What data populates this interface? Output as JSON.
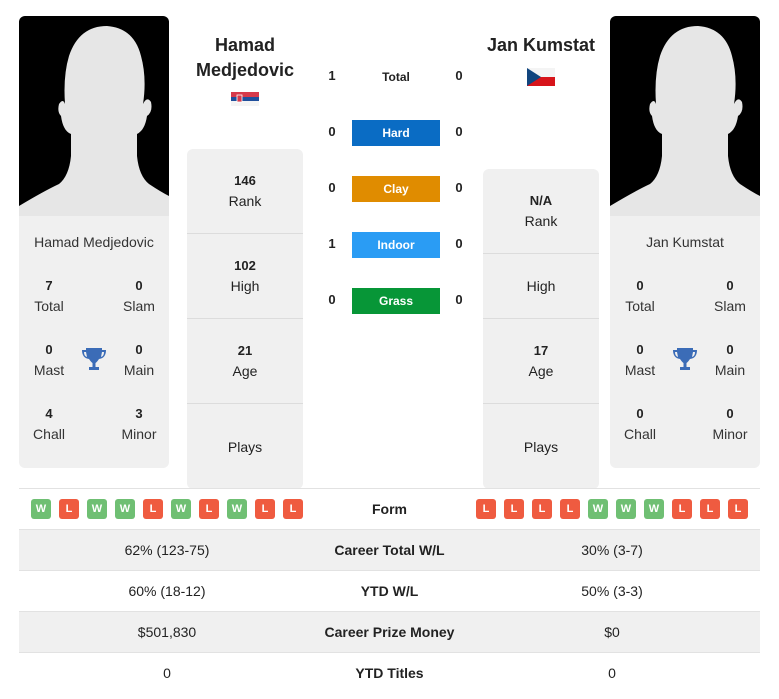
{
  "player1": {
    "name": "Hamad Medjedovic",
    "title_line1": "Hamad",
    "title_line2": "Medjedovic",
    "flag": "serbia-flag",
    "titles": {
      "total": {
        "value": "7",
        "label": "Total"
      },
      "slam": {
        "value": "0",
        "label": "Slam"
      },
      "mast": {
        "value": "0",
        "label": "Mast"
      },
      "main": {
        "value": "0",
        "label": "Main"
      },
      "chall": {
        "value": "4",
        "label": "Chall"
      },
      "minor": {
        "value": "3",
        "label": "Minor"
      }
    },
    "rank": {
      "value": "146",
      "label": "Rank"
    },
    "high": {
      "value": "102",
      "label": "High"
    },
    "age": {
      "value": "21",
      "label": "Age"
    },
    "plays": {
      "value": "",
      "label": "Plays"
    }
  },
  "player2": {
    "name": "Jan Kumstat",
    "title_line1": "Jan Kumstat",
    "flag": "czech-flag",
    "titles": {
      "total": {
        "value": "0",
        "label": "Total"
      },
      "slam": {
        "value": "0",
        "label": "Slam"
      },
      "mast": {
        "value": "0",
        "label": "Mast"
      },
      "main": {
        "value": "0",
        "label": "Main"
      },
      "chall": {
        "value": "0",
        "label": "Chall"
      },
      "minor": {
        "value": "0",
        "label": "Minor"
      }
    },
    "rank": {
      "value": "N/A",
      "label": "Rank"
    },
    "high": {
      "value": "",
      "label": "High"
    },
    "age": {
      "value": "17",
      "label": "Age"
    },
    "plays": {
      "value": "",
      "label": "Plays"
    }
  },
  "h2h": {
    "total": {
      "label": "Total",
      "p1": "1",
      "p2": "0"
    },
    "surfaces": [
      {
        "label": "Hard",
        "p1": "0",
        "p2": "0",
        "color": "#0a6cc4"
      },
      {
        "label": "Clay",
        "p1": "0",
        "p2": "0",
        "color": "#e08c00"
      },
      {
        "label": "Indoor",
        "p1": "1",
        "p2": "0",
        "color": "#2a9cf4"
      },
      {
        "label": "Grass",
        "p1": "0",
        "p2": "0",
        "color": "#079637"
      }
    ]
  },
  "comparison": {
    "form": {
      "label": "Form",
      "p1": [
        "W",
        "L",
        "W",
        "W",
        "L",
        "W",
        "L",
        "W",
        "L",
        "L"
      ],
      "p2": [
        "L",
        "L",
        "L",
        "L",
        "W",
        "W",
        "W",
        "L",
        "L",
        "L"
      ]
    },
    "rows": [
      {
        "label": "Career Total W/L",
        "p1": "62% (123-75)",
        "p2": "30% (3-7)"
      },
      {
        "label": "YTD W/L",
        "p1": "60% (18-12)",
        "p2": "50% (3-3)"
      },
      {
        "label": "Career Prize Money",
        "p1": "$501,830",
        "p2": "$0"
      },
      {
        "label": "YTD Titles",
        "p1": "0",
        "p2": "0"
      }
    ]
  }
}
